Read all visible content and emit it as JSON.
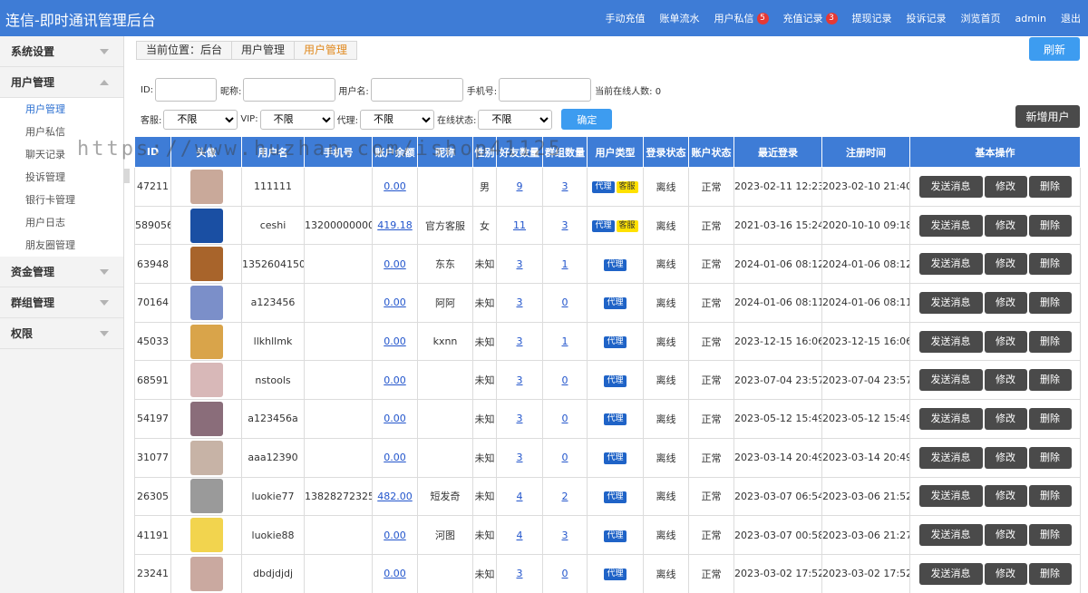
{
  "header": {
    "title": "连信-即时通讯管理后台",
    "nav": [
      {
        "label": "手动充值",
        "badge": ""
      },
      {
        "label": "账单流水",
        "badge": ""
      },
      {
        "label": "用户私信",
        "badge": "5"
      },
      {
        "label": "充值记录",
        "badge": "3"
      },
      {
        "label": "提现记录",
        "badge": ""
      },
      {
        "label": "投诉记录",
        "badge": ""
      },
      {
        "label": "浏览首页",
        "badge": ""
      },
      {
        "label": "admin",
        "badge": ""
      },
      {
        "label": "退出",
        "badge": ""
      }
    ]
  },
  "sidebar": {
    "groups": [
      {
        "label": "系统设置",
        "expanded": false,
        "items": []
      },
      {
        "label": "用户管理",
        "expanded": true,
        "items": [
          "用户管理",
          "用户私信",
          "聊天记录",
          "投诉管理",
          "银行卡管理",
          "用户日志",
          "朋友圈管理"
        ]
      },
      {
        "label": "资金管理",
        "expanded": false,
        "items": []
      },
      {
        "label": "群组管理",
        "expanded": false,
        "items": []
      },
      {
        "label": "权限",
        "expanded": false,
        "items": []
      }
    ],
    "active_item": "用户管理"
  },
  "breadcrumb": [
    "当前位置：后台",
    "用户管理",
    "用户管理"
  ],
  "refresh_label": "刷新",
  "filters": {
    "id_label": "ID:",
    "nickname_label": "昵称:",
    "username_label": "用户名:",
    "phone_label": "手机号:",
    "online_count_label": "当前在线人数: 0",
    "cs_label": "客服:",
    "vip_label": "VIP:",
    "agent_label": "代理:",
    "online_status_label": "在线状态:",
    "select_default": "不限",
    "confirm_label": "确定"
  },
  "add_user_label": "新增用户",
  "table": {
    "headers": [
      "ID",
      "头像",
      "用户名",
      "手机号",
      "账户余额",
      "昵称",
      "性别",
      "好友数量",
      "群组数量",
      "用户类型",
      "登录状态",
      "账户状态",
      "最近登录",
      "注册时间",
      "基本操作"
    ],
    "rows": [
      {
        "id": "47211",
        "username": "111111",
        "phone": "",
        "balance": "0.00",
        "nickname": "",
        "gender": "男",
        "friends": "9",
        "groups": "3",
        "tags": [
          "代理",
          "客服"
        ],
        "login": "离线",
        "status": "正常",
        "last_login": "2023-02-11 12:23",
        "registered": "2023-02-10 21:40",
        "avatar": "#c9a99a"
      },
      {
        "id": "589056",
        "username": "ceshi",
        "phone": "13200000000",
        "balance": "419.18",
        "nickname": "官方客服",
        "gender": "女",
        "friends": "11",
        "groups": "3",
        "tags": [
          "代理",
          "客服"
        ],
        "login": "离线",
        "status": "正常",
        "last_login": "2021-03-16 15:24",
        "registered": "2020-10-10 09:18",
        "avatar": "#1a4fa3"
      },
      {
        "id": "63948",
        "username": "1352604150",
        "phone": "",
        "balance": "0.00",
        "nickname": "东东",
        "gender": "未知",
        "friends": "3",
        "groups": "1",
        "tags": [
          "代理"
        ],
        "login": "离线",
        "status": "正常",
        "last_login": "2024-01-06 08:12",
        "registered": "2024-01-06 08:12",
        "avatar": "#a8642b"
      },
      {
        "id": "70164",
        "username": "a123456",
        "phone": "",
        "balance": "0.00",
        "nickname": "阿阿",
        "gender": "未知",
        "friends": "3",
        "groups": "0",
        "tags": [
          "代理"
        ],
        "login": "离线",
        "status": "正常",
        "last_login": "2024-01-06 08:11",
        "registered": "2024-01-06 08:11",
        "avatar": "#7b8fc9"
      },
      {
        "id": "45033",
        "username": "llkhllmk",
        "phone": "",
        "balance": "0.00",
        "nickname": "kxnn",
        "gender": "未知",
        "friends": "3",
        "groups": "1",
        "tags": [
          "代理"
        ],
        "login": "离线",
        "status": "正常",
        "last_login": "2023-12-15 16:06",
        "registered": "2023-12-15 16:06",
        "avatar": "#d9a44a"
      },
      {
        "id": "68591",
        "username": "nstools",
        "phone": "",
        "balance": "0.00",
        "nickname": "",
        "gender": "未知",
        "friends": "3",
        "groups": "0",
        "tags": [
          "代理"
        ],
        "login": "离线",
        "status": "正常",
        "last_login": "2023-07-04 23:57",
        "registered": "2023-07-04 23:57",
        "avatar": "#d8b8b8"
      },
      {
        "id": "54197",
        "username": "a123456a",
        "phone": "",
        "balance": "0.00",
        "nickname": "",
        "gender": "未知",
        "friends": "3",
        "groups": "0",
        "tags": [
          "代理"
        ],
        "login": "离线",
        "status": "正常",
        "last_login": "2023-05-12 15:49",
        "registered": "2023-05-12 15:49",
        "avatar": "#8a6d7a"
      },
      {
        "id": "31077",
        "username": "aaa12390",
        "phone": "",
        "balance": "0.00",
        "nickname": "",
        "gender": "未知",
        "friends": "3",
        "groups": "0",
        "tags": [
          "代理"
        ],
        "login": "离线",
        "status": "正常",
        "last_login": "2023-03-14 20:49",
        "registered": "2023-03-14 20:49",
        "avatar": "#c7b3a6"
      },
      {
        "id": "26305",
        "username": "luokie77",
        "phone": "13828272325",
        "balance": "482.00",
        "nickname": "短发奇",
        "gender": "未知",
        "friends": "4",
        "groups": "2",
        "tags": [
          "代理"
        ],
        "login": "离线",
        "status": "正常",
        "last_login": "2023-03-07 06:54",
        "registered": "2023-03-06 21:52",
        "avatar": "#9a9a9a"
      },
      {
        "id": "41191",
        "username": "luokie88",
        "phone": "",
        "balance": "0.00",
        "nickname": "河图",
        "gender": "未知",
        "friends": "4",
        "groups": "3",
        "tags": [
          "代理"
        ],
        "login": "离线",
        "status": "正常",
        "last_login": "2023-03-07 00:58",
        "registered": "2023-03-06 21:27",
        "avatar": "#f2d44e"
      },
      {
        "id": "23241",
        "username": "dbdjdjdj",
        "phone": "",
        "balance": "0.00",
        "nickname": "",
        "gender": "未知",
        "friends": "3",
        "groups": "0",
        "tags": [
          "代理"
        ],
        "login": "离线",
        "status": "正常",
        "last_login": "2023-03-02 17:52",
        "registered": "2023-03-02 17:52",
        "avatar": "#caa9a0"
      }
    ],
    "actions": {
      "send": "发送消息",
      "edit": "修改",
      "delete": "删除"
    }
  },
  "watermark": "https://www.huzhan.com/ishop41125"
}
